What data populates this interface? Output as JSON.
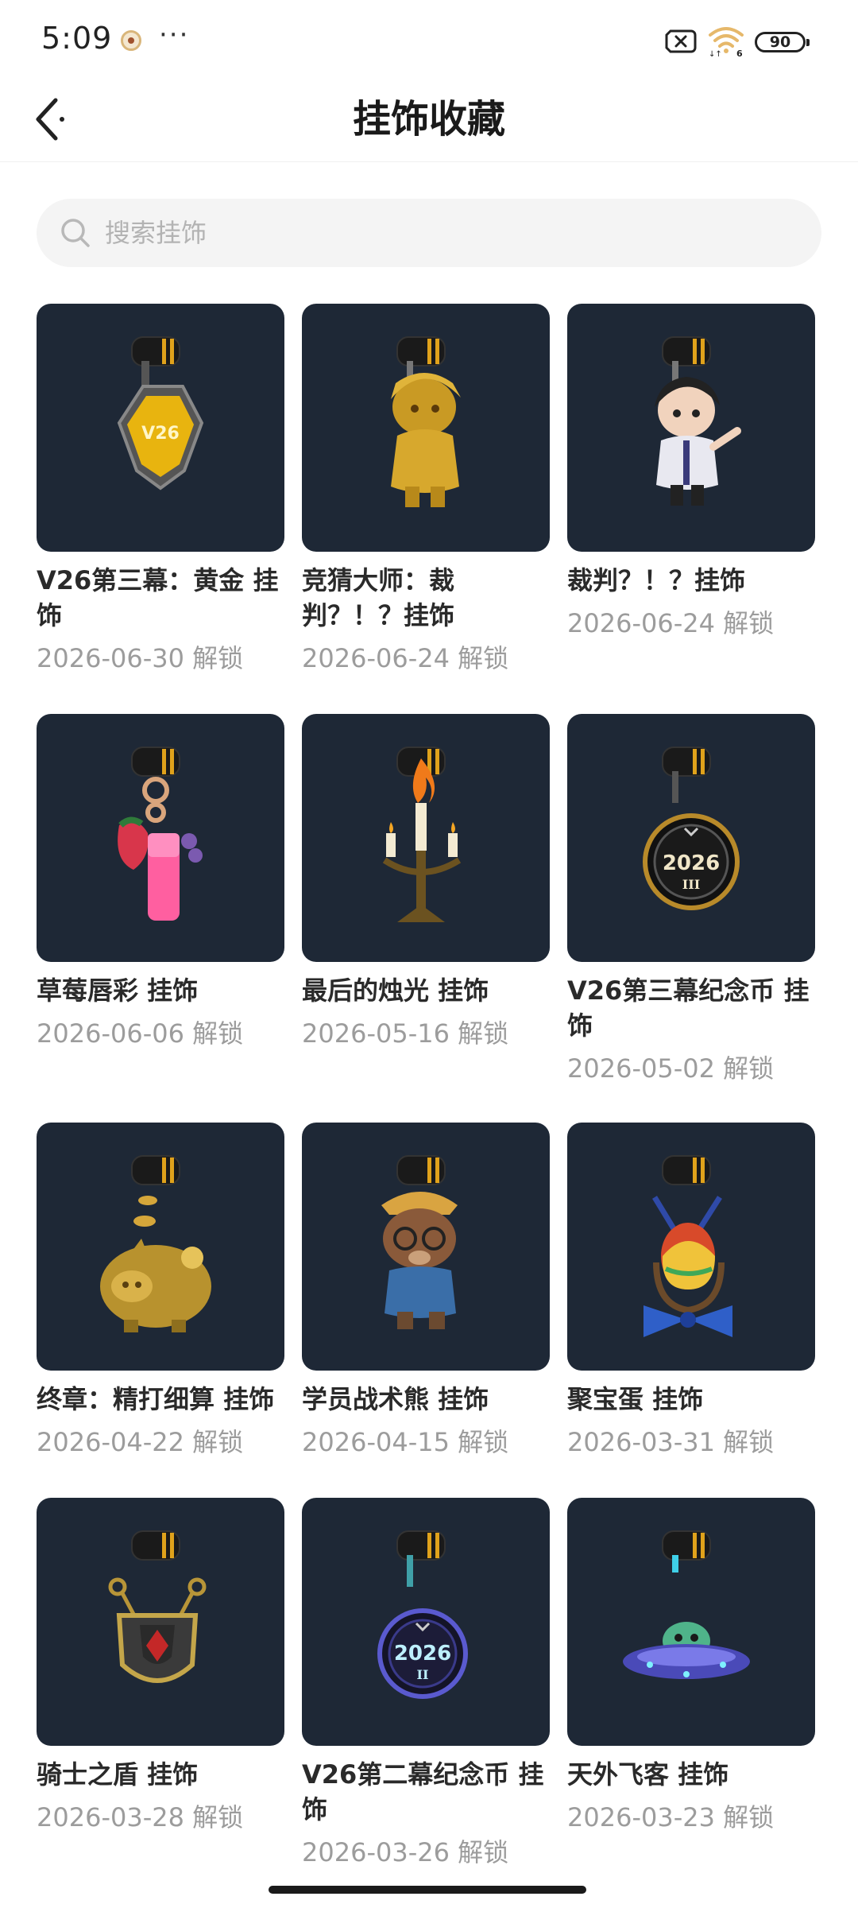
{
  "status_bar": {
    "time": "5:09",
    "more": "···",
    "battery": "90",
    "app_icon": "app-notification-icon",
    "sim_icon": "sim-off-icon",
    "wifi_icon": "wifi-icon"
  },
  "nav": {
    "title": "挂饰收藏",
    "back_icon": "back-arrow-icon"
  },
  "search": {
    "placeholder": "搜索挂饰",
    "value": "",
    "icon": "search-icon"
  },
  "colors": {
    "card_bg": "#1e2836",
    "accent_gold": "#e0a21b",
    "date_gray": "#9c9c9c",
    "search_bg": "#f4f4f4"
  },
  "items": [
    {
      "name": "V26第三幕：黄金 挂饰",
      "date": "2026-06-30 解锁",
      "art": "gold-badge"
    },
    {
      "name": "竞猜大师：裁判？！？挂饰",
      "date": "2026-06-24 解锁",
      "art": "gold-figure"
    },
    {
      "name": "裁判？！？挂饰",
      "date": "2026-06-24 解锁",
      "art": "referee-figure"
    },
    {
      "name": "草莓唇彩 挂饰",
      "date": "2026-06-06 解锁",
      "art": "strawberry-lipgloss"
    },
    {
      "name": "最后的烛光 挂饰",
      "date": "2026-05-16 解锁",
      "art": "candelabra"
    },
    {
      "name": "V26第三幕纪念币 挂饰",
      "date": "2026-05-02 解锁",
      "art": "coin-iii"
    },
    {
      "name": "终章：精打细算 挂饰",
      "date": "2026-04-22 解锁",
      "art": "gold-piggy"
    },
    {
      "name": "学员战术熊 挂饰",
      "date": "2026-04-15 解锁",
      "art": "tactical-bear"
    },
    {
      "name": "聚宝蛋 挂饰",
      "date": "2026-03-31 解锁",
      "art": "treasure-egg"
    },
    {
      "name": "骑士之盾 挂饰",
      "date": "2026-03-28 解锁",
      "art": "knight-shield"
    },
    {
      "name": "V26第二幕纪念币 挂饰",
      "date": "2026-03-26 解锁",
      "art": "coin-ii"
    },
    {
      "name": "天外飞客 挂饰",
      "date": "2026-03-23 解锁",
      "art": "ufo"
    }
  ]
}
